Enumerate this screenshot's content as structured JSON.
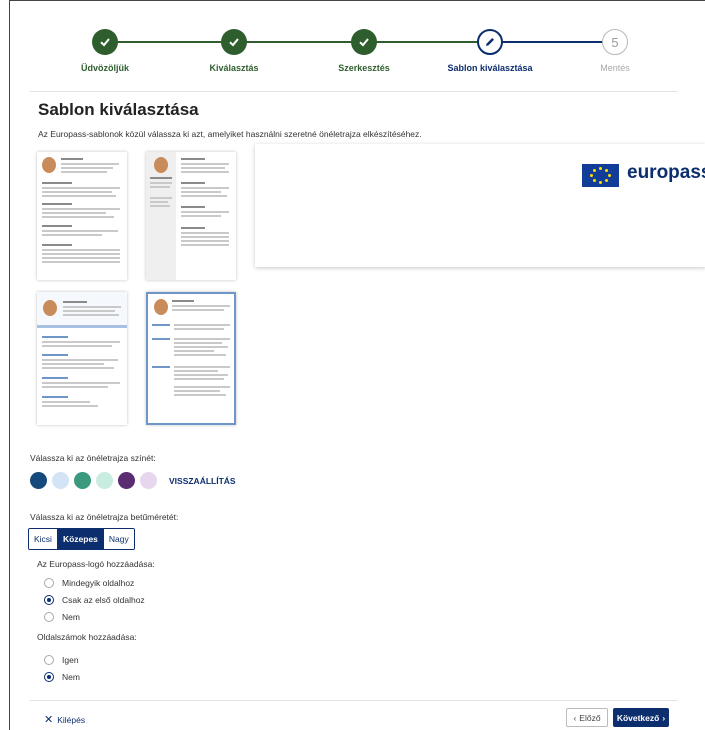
{
  "stepper": {
    "steps": [
      {
        "label": "Üdvözöljük",
        "state": "done"
      },
      {
        "label": "Kiválasztás",
        "state": "done"
      },
      {
        "label": "Szerkesztés",
        "state": "done"
      },
      {
        "label": "Sablon kiválasztása",
        "state": "active"
      },
      {
        "label": "Mentés",
        "state": "todo",
        "number": "5"
      }
    ]
  },
  "page": {
    "title": "Sablon kiválasztása",
    "description": "Az Europass-sablonok közül válassza ki azt, amelyiket használni szeretné önéletrajza elkészítéséhez."
  },
  "preview": {
    "logo_text": "europass"
  },
  "color": {
    "label": "Válassza ki az önéletrajza színét:",
    "swatches": [
      "#174a7c",
      "#d2e4f5",
      "#3b9a7e",
      "#c8ece0",
      "#5a2d73",
      "#e6d6ee"
    ],
    "reset_label": "VISSZAÁLLÍTÁS"
  },
  "font_size": {
    "label": "Válassza ki az önéletrajza betűméretét:",
    "options": [
      "Kicsi",
      "Közepes",
      "Nagy"
    ],
    "selected": "Közepes"
  },
  "logo": {
    "label": "Az Europass-logó hozzáadása:",
    "options": [
      "Mindegyik oldalhoz",
      "Csak az első oldalhoz",
      "Nem"
    ],
    "selected": "Csak az első oldalhoz"
  },
  "page_numbers": {
    "label": "Oldalszámok hozzáadása:",
    "options": [
      "Igen",
      "Nem"
    ],
    "selected": "Nem"
  },
  "footer": {
    "exit_label": "Kilépés",
    "prev_label": "Előző",
    "next_label": "Következő"
  },
  "colors": {
    "primary": "#0c2e6e",
    "done_green": "#2e5e2e",
    "eu_blue": "#113d98",
    "eu_yellow": "#ffdd00"
  }
}
